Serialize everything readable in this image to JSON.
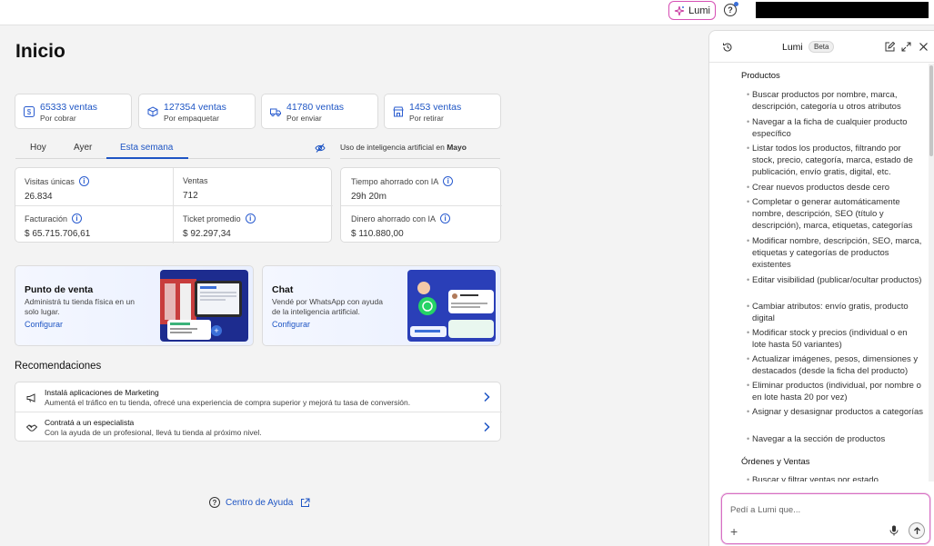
{
  "topbar": {
    "lumi_label": "Lumi",
    "help_glyph": "?"
  },
  "page": {
    "title": "Inicio"
  },
  "stats": [
    {
      "value": "65333 ventas",
      "label": "Por cobrar",
      "icon": "dollar-icon"
    },
    {
      "value": "127354 ventas",
      "label": "Por empaquetar",
      "icon": "package-icon"
    },
    {
      "value": "41780 ventas",
      "label": "Por enviar",
      "icon": "truck-icon"
    },
    {
      "value": "1453 ventas",
      "label": "Por retirar",
      "icon": "store-icon"
    }
  ],
  "tabs": [
    {
      "label": "Hoy",
      "active": false
    },
    {
      "label": "Ayer",
      "active": false
    },
    {
      "label": "Esta semana",
      "active": true
    }
  ],
  "ai_usage": {
    "prefix": "Uso de inteligencia artificial en ",
    "month": "Mayo"
  },
  "metrics": [
    {
      "label": "Visitas únicas",
      "value": "26.834"
    },
    {
      "label": "Ventas",
      "value": "712"
    },
    {
      "label": "Facturación",
      "value": "$ 65.715.706,61"
    },
    {
      "label": "Ticket promedio",
      "value": "$ 92.297,34"
    }
  ],
  "ai_metrics": [
    {
      "label": "Tiempo ahorrado con IA",
      "value": "29h 20m"
    },
    {
      "label": "Dinero ahorrado con IA",
      "value": "$ 110.880,00"
    }
  ],
  "promos": [
    {
      "title": "Punto de venta",
      "desc": "Administrá tu tienda física en un solo lugar.",
      "link": "Configurar"
    },
    {
      "title": "Chat",
      "desc": "Vendé por WhatsApp con ayuda de la inteligencia artificial.",
      "link": "Configurar"
    }
  ],
  "recommendations": {
    "title": "Recomendaciones",
    "items": [
      {
        "title": "Instalá aplicaciones de Marketing",
        "desc": "Aumentá el tráfico en tu tienda, ofrecé una experiencia de compra superior y mejorá tu tasa de conversión."
      },
      {
        "title": "Contratá a un especialista",
        "desc": "Con la ayuda de un profesional, llevá tu tienda al próximo nivel."
      }
    ]
  },
  "help_center": {
    "label": "Centro de Ayuda"
  },
  "panel": {
    "title": "Lumi",
    "badge": "Beta",
    "sections": [
      {
        "title": "Productos",
        "items": [
          "Buscar productos por nombre, marca, descripción, categoría u otros atributos",
          "Navegar a la ficha de cualquier producto específico",
          "Listar todos los productos, filtrando por stock, precio, categoría, marca, estado de publicación, envío gratis, digital, etc.",
          "Crear nuevos productos desde cero",
          "Completar o generar automáticamente nombre, descripción, SEO (título y descripción), marca, etiquetas, categorías",
          "Modificar nombre, descripción, SEO, marca, etiquetas y categorías de productos existentes",
          "Editar visibilidad (publicar/ocultar productos)",
          "Cambiar atributos: envío gratis, producto digital",
          "Modificar stock y precios (individual o en lote hasta 50 variantes)",
          "Actualizar imágenes, pesos, dimensiones y destacados (desde la ficha del producto)",
          "Eliminar productos (individual, por nombre o en lote hasta 20 por vez)",
          "Asignar y desasignar productos a categorías",
          "Navegar a la sección de productos"
        ]
      },
      {
        "title": "Órdenes y Ventas",
        "items": [
          "Buscar y filtrar ventas por estado"
        ]
      }
    ],
    "input_placeholder": "Pedí a Lumi que..."
  }
}
